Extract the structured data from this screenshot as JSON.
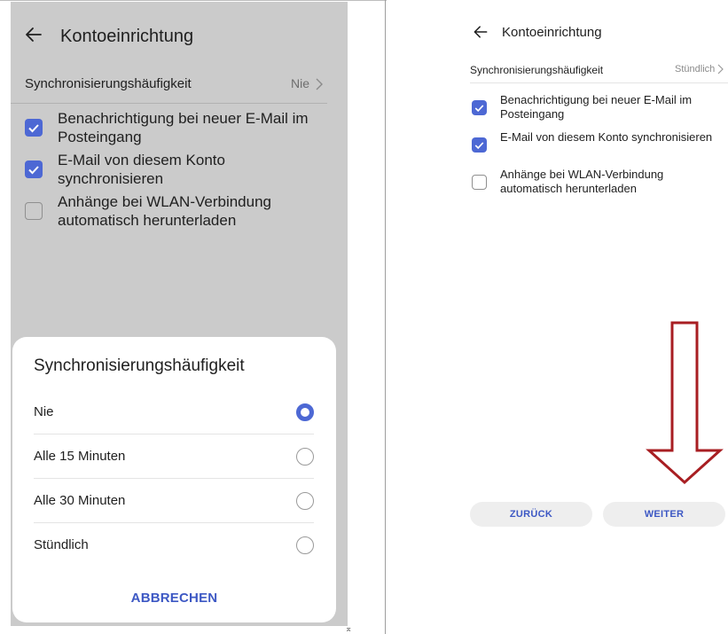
{
  "left": {
    "header": {
      "back_icon": "arrow-left-icon",
      "title": "Kontoeinrichtung"
    },
    "sync": {
      "label": "Synchronisierungshäufigkeit",
      "value": "Nie",
      "chevron_icon": "chevron-right-icon"
    },
    "checkboxes": [
      {
        "label": "Benachrichtigung bei neuer E-Mail im Posteingang",
        "checked": true
      },
      {
        "label": "E-Mail von diesem Konto synchronisieren",
        "checked": true
      },
      {
        "label": "Anhänge bei WLAN-Verbindung automatisch herunterladen",
        "checked": false
      }
    ],
    "sheet": {
      "title": "Synchronisierungshäufigkeit",
      "options": [
        {
          "label": "Nie",
          "selected": true
        },
        {
          "label": "Alle 15 Minuten",
          "selected": false
        },
        {
          "label": "Alle 30 Minuten",
          "selected": false
        },
        {
          "label": "Stündlich",
          "selected": false
        }
      ],
      "cancel_label": "ABBRECHEN"
    }
  },
  "right": {
    "header": {
      "back_icon": "arrow-left-icon",
      "title": "Kontoeinrichtung"
    },
    "sync": {
      "label": "Synchronisierungshäufigkeit",
      "value": "Stündlich",
      "chevron_icon": "chevron-right-icon"
    },
    "checkboxes": [
      {
        "label": "Benachrichtigung bei neuer E-Mail im Posteingang",
        "checked": true
      },
      {
        "label": "E-Mail von diesem Konto synchronisieren",
        "checked": true
      },
      {
        "label": "Anhänge bei WLAN-Verbindung automatisch herunterladen",
        "checked": false
      }
    ],
    "buttons": {
      "back_label": "ZURÜCK",
      "next_label": "WEITER"
    },
    "annotation": {
      "icon": "down-arrow-outline",
      "color": "#a81e22"
    }
  },
  "colors": {
    "accent": "#4d68d4",
    "button_text": "#3d58c4",
    "overlay": "#cbcbcb"
  }
}
